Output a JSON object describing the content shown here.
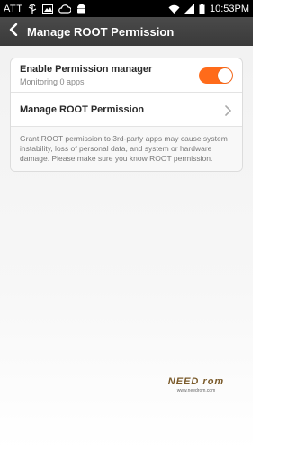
{
  "status_bar": {
    "carrier": "ATT",
    "clock": "10:53PM",
    "icons": [
      "usb-icon",
      "image-icon",
      "cloud-icon",
      "android-icon",
      "wifi-icon",
      "signal-icon",
      "battery-icon"
    ]
  },
  "header": {
    "title": "Manage ROOT Permission",
    "back_icon": "back-arrow-icon"
  },
  "settings": {
    "enable_row": {
      "title": "Enable Permission manager",
      "subtitle": "Monitoring 0 apps",
      "toggle_on": true,
      "toggle_color": "#ff6b1a"
    },
    "manage_row": {
      "title": "Manage ROOT Permission",
      "icon": "chevron-right-icon"
    },
    "note": "Grant ROOT permission to 3rd-party apps may cause system instability, loss of personal data, and system or hardware damage. Please make sure you know ROOT permission."
  },
  "watermark": {
    "logo": "NEED rom",
    "url": "www.needrom.com"
  }
}
